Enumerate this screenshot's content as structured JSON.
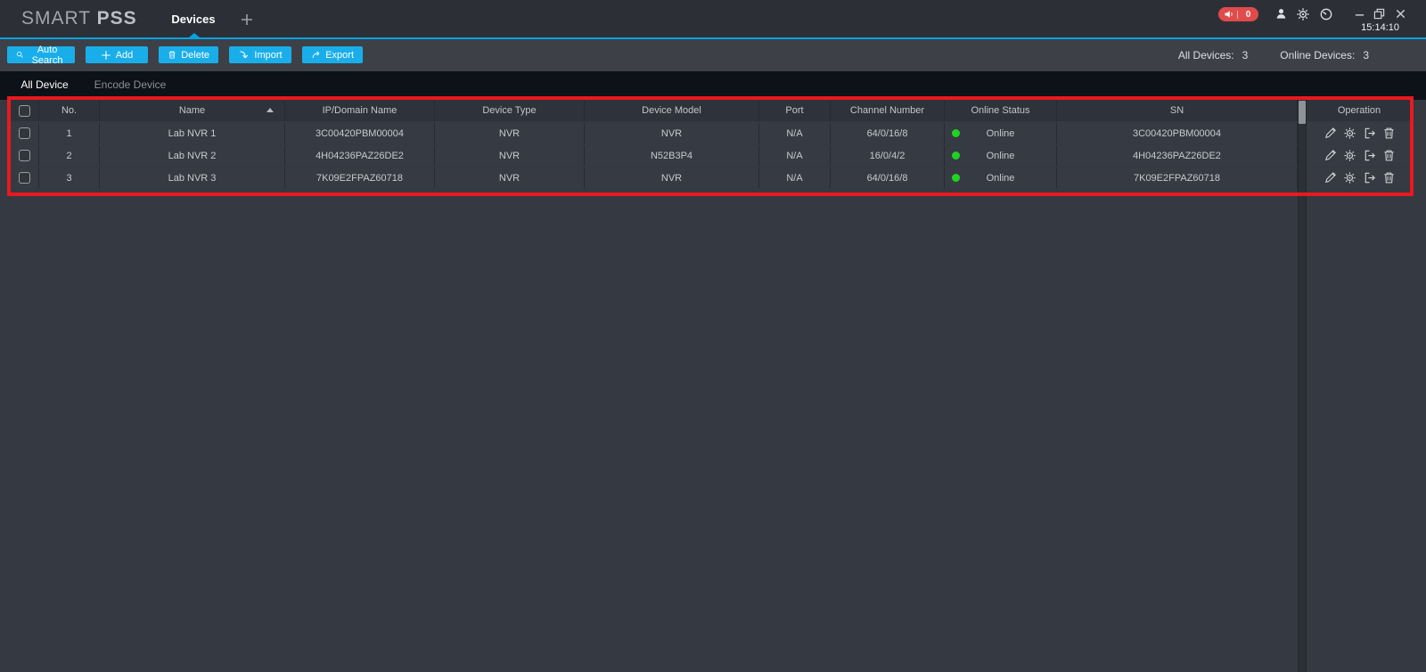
{
  "app": {
    "brand_light": "SMART",
    "brand_bold": "PSS"
  },
  "titlebar": {
    "active_tab": "Devices",
    "alarm_count": "0",
    "time": "15:14:10"
  },
  "toolbar": {
    "buttons": [
      {
        "label": "Auto Search",
        "icon": "search-icon"
      },
      {
        "label": "Add",
        "icon": "plus-icon"
      },
      {
        "label": "Delete",
        "icon": "trash-icon"
      },
      {
        "label": "Import",
        "icon": "import-icon"
      },
      {
        "label": "Export",
        "icon": "export-icon"
      }
    ],
    "stats": {
      "all_label": "All Devices:",
      "all_count": "3",
      "online_label": "Online Devices:",
      "online_count": "3"
    }
  },
  "tabs": [
    {
      "label": "All Device",
      "active": true
    },
    {
      "label": "Encode Device",
      "active": false
    }
  ],
  "table": {
    "columns": [
      "No.",
      "Name",
      "IP/Domain Name",
      "Device Type",
      "Device Model",
      "Port",
      "Channel Number",
      "Online Status",
      "SN",
      "Operation"
    ],
    "sort": {
      "column": "Name",
      "direction": "ascending"
    },
    "operations": [
      "edit",
      "config",
      "logout",
      "delete"
    ],
    "rows": [
      {
        "no": "1",
        "name": "Lab NVR 1",
        "ip": "3C00420PBM00004",
        "type": "NVR",
        "model": "NVR",
        "port": "N/A",
        "channels": "64/0/16/8",
        "status": "Online",
        "sn": "3C00420PBM00004"
      },
      {
        "no": "2",
        "name": "Lab NVR 2",
        "ip": "4H04236PAZ26DE2",
        "type": "NVR",
        "model": "N52B3P4",
        "port": "N/A",
        "channels": "16/0/4/2",
        "status": "Online",
        "sn": "4H04236PAZ26DE2"
      },
      {
        "no": "3",
        "name": "Lab NVR 3",
        "ip": "7K09E2FPAZ60718",
        "type": "NVR",
        "model": "NVR",
        "port": "N/A",
        "channels": "64/0/16/8",
        "status": "Online",
        "sn": "7K09E2FPAZ60718"
      }
    ]
  },
  "colors": {
    "accent_cyan": "#19aeea",
    "annotation_red": "#e8191f",
    "online_green": "#1fd321",
    "alarm_red": "#e04b4b",
    "titlebar_bg": "#2c3036",
    "row_bg": "#363a42"
  }
}
